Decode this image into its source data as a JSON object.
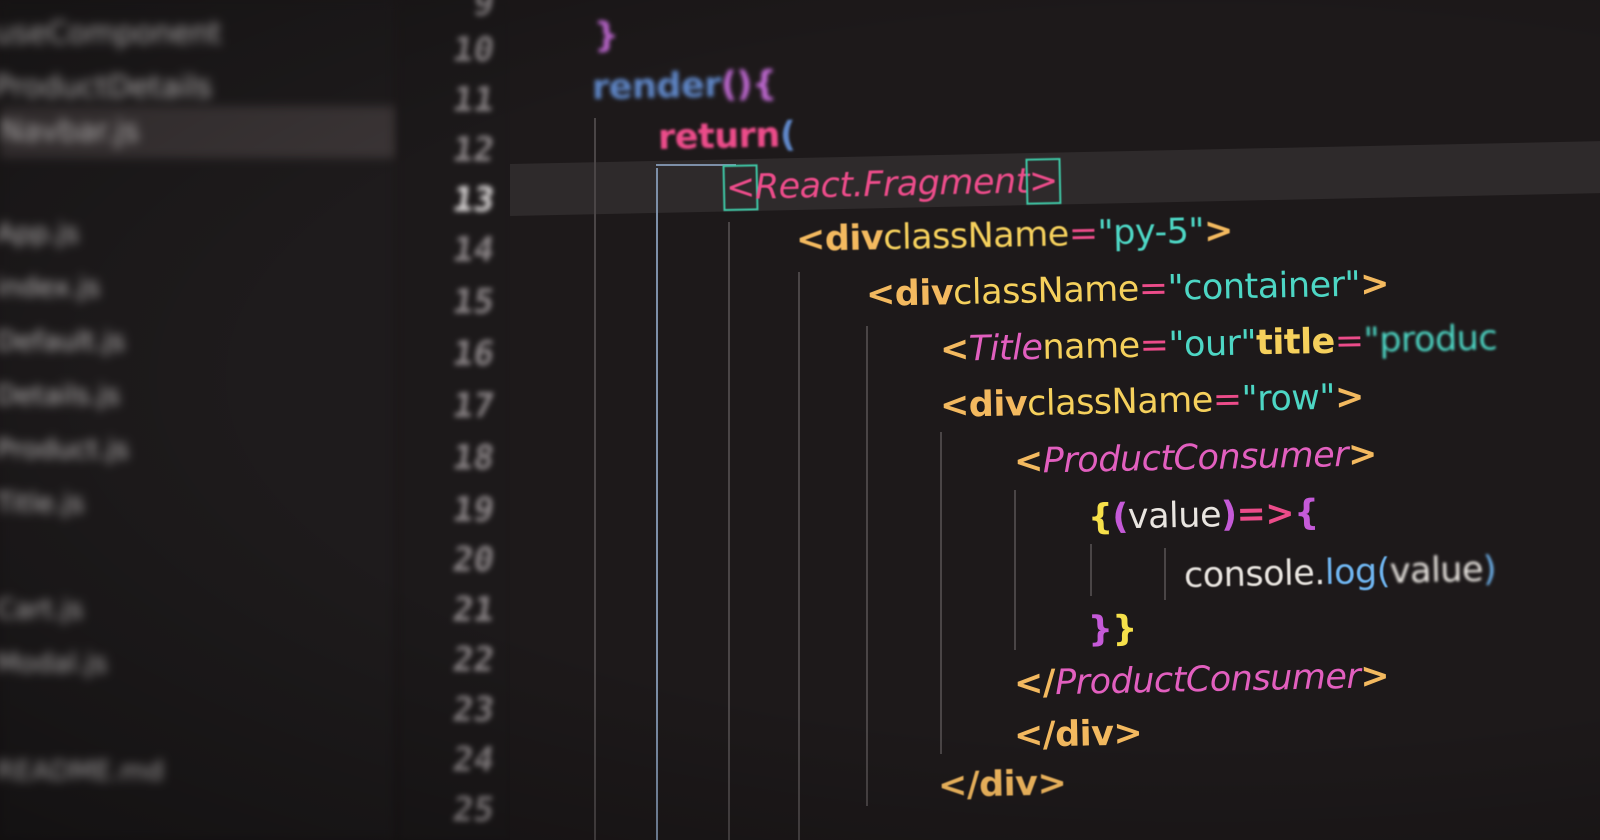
{
  "sidebar": {
    "items": [
      {
        "label": "useComponent"
      },
      {
        "label": "ProductDetails"
      },
      {
        "label": "Navbar.js"
      },
      {
        "label": "App.js"
      },
      {
        "label": "index.js"
      },
      {
        "label": "Default.js"
      },
      {
        "label": "Details.js"
      },
      {
        "label": "Product.js"
      },
      {
        "label": "Title.js"
      },
      {
        "label": "Cart.js"
      },
      {
        "label": "Modal.js"
      },
      {
        "label": "README.md"
      }
    ]
  },
  "gutter": {
    "line_numbers": [
      "9",
      "10",
      "11",
      "12",
      "13",
      "14",
      "15",
      "16",
      "17",
      "18",
      "19",
      "20",
      "21",
      "22",
      "23",
      "24",
      "25"
    ]
  },
  "code": {
    "line_brace_close": "}",
    "render_kw": "render",
    "render_parens": "()",
    "render_brace": " {",
    "return_kw": "return",
    "return_paren": " (",
    "frag_open": "<",
    "frag_name": "React.Fragment",
    "frag_close": ">",
    "div1_open": "<div",
    "div1_attr": " className",
    "div1_eq": "=",
    "div1_value": "\"py-5\"",
    "div1_close": ">",
    "div2_open": "<div",
    "div2_attr": " className",
    "div2_eq": "=",
    "div2_value": "\"container\"",
    "div2_close": ">",
    "title_open": "<",
    "title_name": "Title",
    "title_attr1": " name",
    "title_eq1": "=",
    "title_value1": "\"our\"",
    "title_attr2": " title",
    "title_eq2": "=",
    "title_value2": " \"produc",
    "div3_open": "<div",
    "div3_attr": " className",
    "div3_eq": "=",
    "div3_value": "\"row\"",
    "div3_close": ">",
    "consumer_open": "<",
    "consumer_name": "ProductConsumer",
    "consumer_close": ">",
    "arrow_brace": "{",
    "arrow_paren_open": "(",
    "arrow_param": "value",
    "arrow_paren_close": ")",
    "arrow_op": " => ",
    "arrow_body_brace": "{",
    "console_obj": "console",
    "console_dot": ".",
    "console_fn": "log",
    "console_paren_open": "(",
    "console_arg": "value",
    "console_paren_close": ")",
    "close_braces_1": "}",
    "close_braces_2": "}",
    "consumer_end_open": "</",
    "consumer_end_name": "ProductConsumer",
    "consumer_end_close": ">",
    "div_end_1": "</div>",
    "div_end_2": "</div>"
  },
  "colors": {
    "background": "#1d191a",
    "keyword_return": "#ec4c8a",
    "function_render": "#5f87c8",
    "tag": "#f3b95f",
    "attribute": "#f5d05c",
    "string": "#4dd6c4",
    "component": "#e25fbf",
    "bracket_match": "#3ec7a5"
  }
}
